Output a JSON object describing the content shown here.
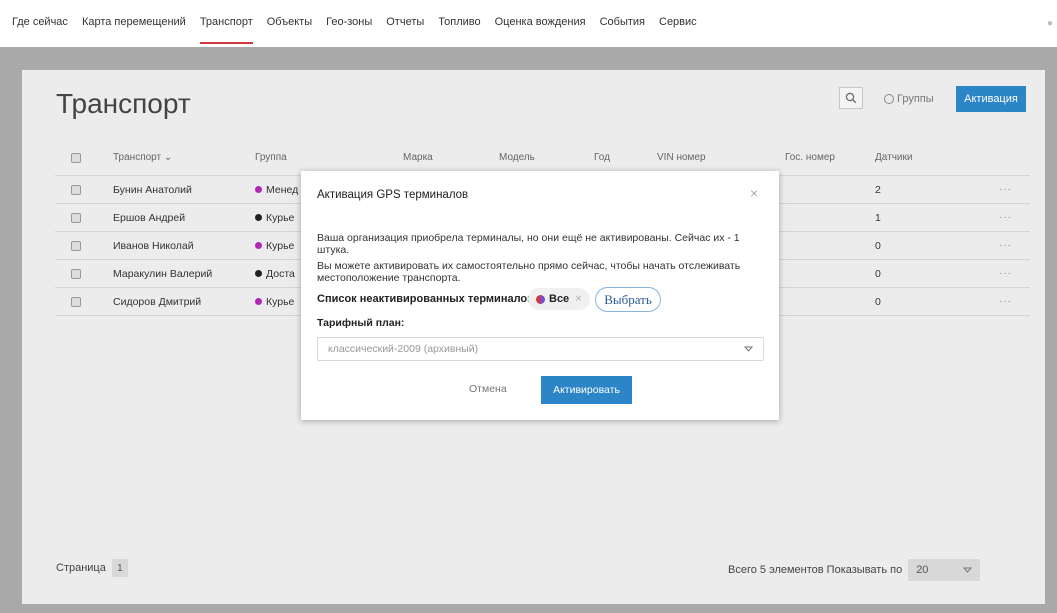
{
  "nav": {
    "items": [
      {
        "label": "Где сейчас",
        "active": false
      },
      {
        "label": "Карта перемещений",
        "active": false
      },
      {
        "label": "Транспорт",
        "active": true
      },
      {
        "label": "Объекты",
        "active": false
      },
      {
        "label": "Гео-зоны",
        "active": false
      },
      {
        "label": "Отчеты",
        "active": false
      },
      {
        "label": "Топливо",
        "active": false
      },
      {
        "label": "Оценка вождения",
        "active": false
      },
      {
        "label": "События",
        "active": false
      },
      {
        "label": "Сервис",
        "active": false
      }
    ]
  },
  "page": {
    "title": "Транспорт",
    "groups_label": "Группы",
    "activate_label": "Активация"
  },
  "table": {
    "columns": [
      "Транспорт",
      "Группа",
      "Марка",
      "Модель",
      "Год",
      "VIN номер",
      "Гос. номер",
      "Датчики"
    ],
    "rows": [
      {
        "name": "Бунин Анатолий",
        "group": "Менед",
        "group_color": "#b028b8",
        "sensors": "2"
      },
      {
        "name": "Ершов Андрей",
        "group": "Курье",
        "group_color": "#222222",
        "sensors": "1"
      },
      {
        "name": "Иванов Николай",
        "group": "Курье",
        "group_color": "#b028b8",
        "sensors": "0"
      },
      {
        "name": "Маракулин Валерий",
        "group": "Доста",
        "group_color": "#222222",
        "sensors": "0"
      },
      {
        "name": "Сидоров Дмитрий",
        "group": "Курье",
        "group_color": "#b028b8",
        "sensors": "0"
      }
    ],
    "more": "···"
  },
  "footer": {
    "page_label": "Страница",
    "page_number": "1",
    "total_label": "Всего 5 элементов Показывать по",
    "per_page": "20"
  },
  "modal": {
    "title": "Активация GPS терминалов",
    "close": "×",
    "text1": "Ваша организация приобрела терминалы, но они ещё не активированы. Сейчас их - 1 штука.",
    "text2": "Вы можете активировать их самостоятельно прямо сейчас, чтобы начать отслеживать местоположение транспорта.",
    "list_label": "Список неактивированных терминалов:",
    "chip_label": "Все",
    "chip_close": "×",
    "select_label": "Выбрать",
    "plan_label": "Тарифный план:",
    "plan_value": "классический-2009 (архивный)",
    "cancel_label": "Отмена",
    "confirm_label": "Активировать"
  },
  "colors": {
    "accent": "#2b85c7",
    "nav_active": "#d2373c"
  }
}
